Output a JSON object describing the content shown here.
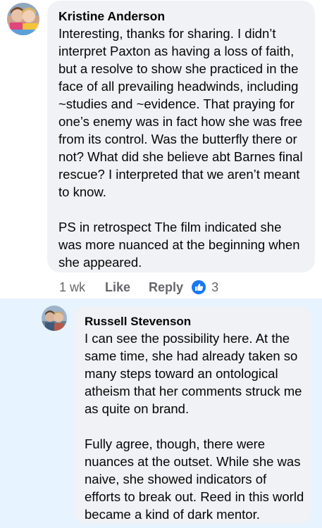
{
  "comment": {
    "author": "Kristine Anderson",
    "paragraphs": [
      "Interesting, thanks for sharing. I didn’t interpret Paxton as having a loss of faith, but a resolve to show she practiced in the face of all prevailing headwinds, including ~studies and ~evidence. That praying for one’s enemy was in fact how she was free from its control. Was the butterfly there or not? What did she believe abt Barnes final rescue? I interpreted that we aren’t meant to know.",
      "PS in retrospect The film indicated she was more nuanced at the beginning when she appeared."
    ],
    "time": "1 wk",
    "like_label": "Like",
    "reply_label": "Reply",
    "reaction_icon": "like-icon",
    "reaction_count": "3"
  },
  "reply": {
    "author": "Russell Stevenson",
    "paragraphs": [
      "I can see the possibility here.  At the same time, she had already taken so many steps toward an ontological atheism that her comments struck me as quite on brand.",
      "Fully agree, though, there were nuances at the outset. While she was naive, she showed indicators of efforts to break out. Reed in this world became a kind of dark mentor."
    ]
  },
  "colors": {
    "bubble": "#f0f2f5",
    "highlight": "#e7f3ff",
    "meta_text": "#65676b",
    "like_blue": "#1877f2"
  }
}
